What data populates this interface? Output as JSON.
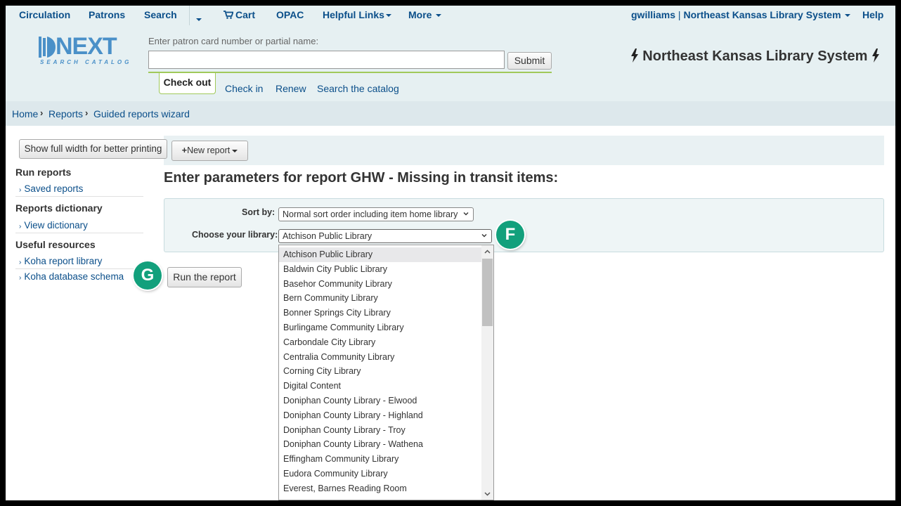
{
  "topnav": {
    "circulation": "Circulation",
    "patrons": "Patrons",
    "search": "Search",
    "cart": "Cart",
    "opac": "OPAC",
    "helpful_links": "Helpful Links",
    "more": "More",
    "user": "gwilliams",
    "library": "Northeast Kansas Library System",
    "help": "Help"
  },
  "header": {
    "logo_word": "NEXT",
    "logo_sub": "SEARCH CATALOG",
    "patron_placeholder": "Enter patron card number or partial name:",
    "patron_value": "",
    "submit": "Submit",
    "tabs": [
      "Check out",
      "Check in",
      "Renew",
      "Search the catalog"
    ],
    "system_name": "Northeast Kansas Library System"
  },
  "breadcrumb": [
    "Home",
    "Reports",
    "Guided reports wizard"
  ],
  "toolbar": {
    "show_full": "Show full width for better printing",
    "new_report": "New report"
  },
  "sidebar": {
    "sections": [
      {
        "heading": "Run reports",
        "links": [
          "Saved reports"
        ]
      },
      {
        "heading": "Reports dictionary",
        "links": [
          "View dictionary"
        ]
      },
      {
        "heading": "Useful resources",
        "links": [
          "Koha report library",
          "Koha database schema"
        ]
      }
    ]
  },
  "main": {
    "title": "Enter parameters for report GHW - Missing in transit items:",
    "sort_label": "Sort by:",
    "sort_value": "Normal sort order including item home library",
    "library_label": "Choose your library:",
    "library_value": "Atchison Public Library",
    "run_button": "Run the report"
  },
  "library_options": [
    "Atchison Public Library",
    "Baldwin City Public Library",
    "Basehor Community Library",
    "Bern Community Library",
    "Bonner Springs City Library",
    "Burlingame Community Library",
    "Carbondale City Library",
    "Centralia Community Library",
    "Corning City Library",
    "Digital Content",
    "Doniphan County Library - Elwood",
    "Doniphan County Library - Highland",
    "Doniphan County Library - Troy",
    "Doniphan County Library - Wathena",
    "Effingham Community Library",
    "Eudora Community Library",
    "Everest, Barnes Reading Room"
  ],
  "annotations": {
    "f": "F",
    "g": "G"
  },
  "colors": {
    "accent_link": "#0b4f8a",
    "badge": "#12a07c",
    "header_bg": "#e6f0f2",
    "tab_border": "#a0c95a"
  }
}
